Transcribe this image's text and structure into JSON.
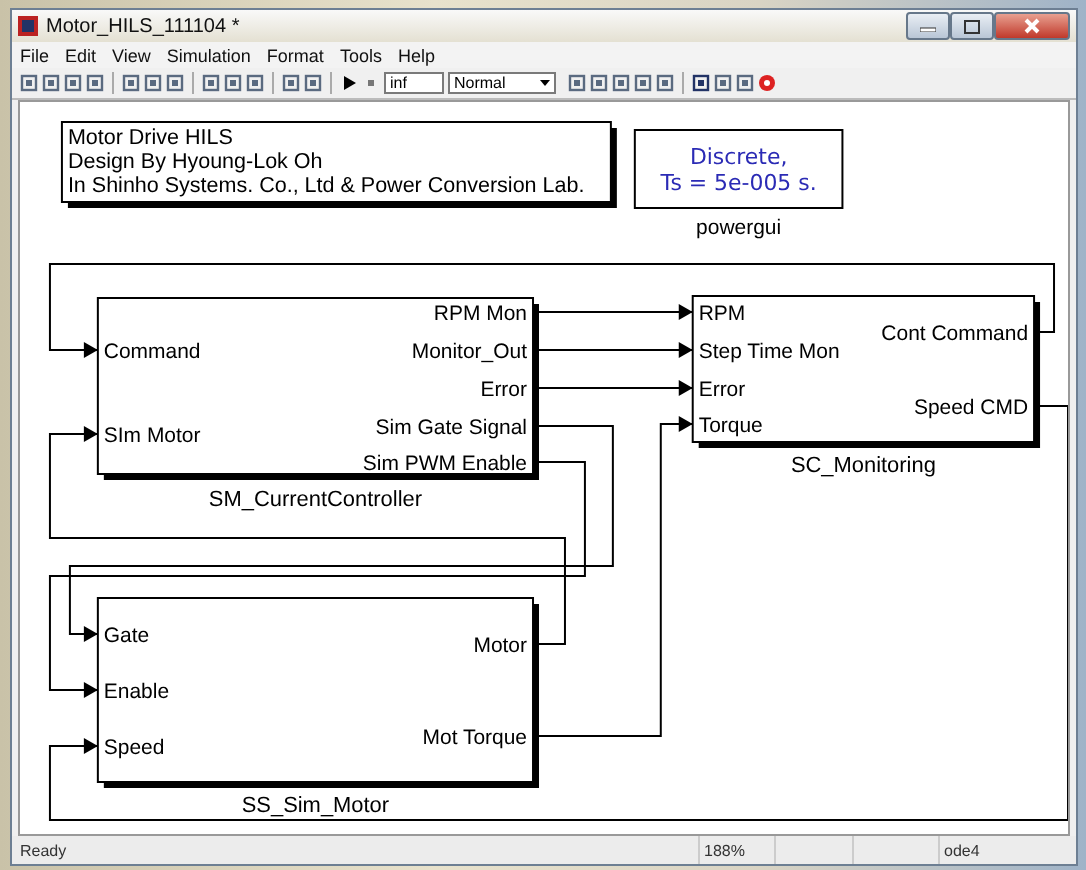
{
  "window": {
    "title": "Motor_HILS_111104 *"
  },
  "menu": [
    "File",
    "Edit",
    "View",
    "Simulation",
    "Format",
    "Tools",
    "Help"
  ],
  "toolbar": {
    "stop_time": "inf",
    "mode": "Normal"
  },
  "annotation": {
    "lines": [
      "Motor Drive HILS",
      "Design By Hyoung-Lok Oh",
      "In Shinho Systems. Co., Ltd & Power Conversion Lab."
    ]
  },
  "powergui": {
    "lines": [
      "Discrete,",
      "Ts = 5e-005 s."
    ],
    "label": "powergui"
  },
  "blocks": [
    {
      "name": "SM_CurrentController",
      "inputs": [
        "Command",
        "SIm Motor"
      ],
      "outputs": [
        "RPM Mon",
        "Monitor_Out",
        "Error",
        "Sim Gate Signal",
        "Sim PWM Enable"
      ]
    },
    {
      "name": "SC_Monitoring",
      "inputs": [
        "RPM",
        "Step Time Mon",
        "Error",
        "Torque"
      ],
      "outputs": [
        "Cont Command",
        "Speed CMD"
      ]
    },
    {
      "name": "SS_Sim_Motor",
      "inputs": [
        "Gate",
        "Enable",
        "Speed"
      ],
      "outputs": [
        "Motor",
        "Mot Torque"
      ]
    }
  ],
  "status_bar": {
    "message": "Ready",
    "zoom": "188%",
    "solver": "ode4"
  }
}
